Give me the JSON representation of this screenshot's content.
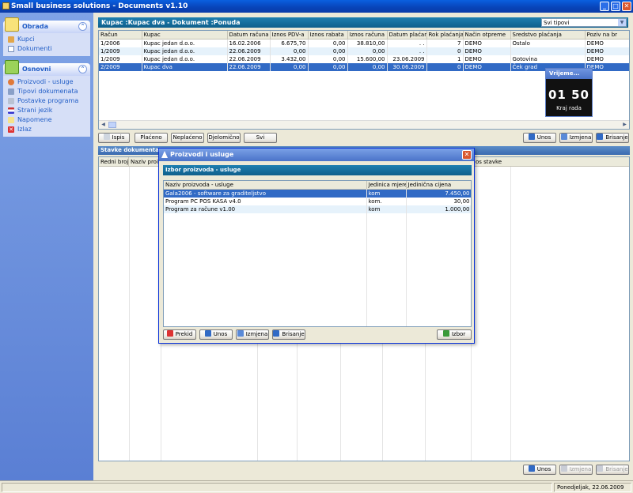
{
  "window": {
    "title": "Small business solutions - Documents v1.10"
  },
  "sidebar": {
    "groups": [
      {
        "title": "Obrada",
        "items": [
          "Kupci",
          "Dokumenti"
        ]
      },
      {
        "title": "Osnovni",
        "items": [
          "Proizvodi - usluge",
          "Tipovi dokumenata",
          "Postavke programa",
          "Strani jezik",
          "Napomene",
          "Izlaz"
        ]
      }
    ]
  },
  "documents": {
    "header": "Kupac :Kupac dva - Dokument :Ponuda",
    "filter_value": "Svi tipovi",
    "columns": [
      "Račun",
      "Kupac",
      "Datum računa",
      "Iznos PDV-a",
      "Iznos rabata",
      "Iznos računa",
      "Datum plaćanja",
      "Rok plaćanja",
      "Način otpreme",
      "Sredstvo plaćanja",
      "Poziv na br"
    ],
    "rows": [
      [
        "1/2006",
        "Kupac jedan d.o.o.",
        "16.02.2006",
        "6.675,70",
        "0,00",
        "38.810,00",
        ". .",
        "7",
        "DEMO",
        "Ostalo",
        "DEMO"
      ],
      [
        "1/2009",
        "Kupac jedan d.o.o.",
        "22.06.2009",
        "0,00",
        "0,00",
        "0,00",
        ". .",
        "0",
        "DEMO",
        "",
        "DEMO"
      ],
      [
        "1/2009",
        "Kupac jedan d.o.o.",
        "22.06.2009",
        "3.432,00",
        "0,00",
        "15.600,00",
        "23.06.2009",
        "1",
        "DEMO",
        "Gotovina",
        "DEMO"
      ],
      [
        "2/2009",
        "Kupac dva",
        "22.06.2009",
        "0,00",
        "0,00",
        "0,00",
        "30.06.2009",
        "0",
        "DEMO",
        "Ček grad",
        "DEMO"
      ]
    ]
  },
  "doc_buttons": {
    "ispis": "Ispis",
    "placeno": "Plaćeno",
    "neplaceno": "Neplaćeno",
    "djelomicno": "Djelomično",
    "svi": "Svi",
    "unos": "Unos",
    "izmjena": "Izmjena",
    "brisanje": "Brisanje"
  },
  "items": {
    "header": "Stavke dokumenta 2",
    "columns": [
      "Redni broj",
      "Naziv proizv",
      "os stavke"
    ]
  },
  "items_buttons": {
    "unos": "Unos",
    "izmjena": "Izmjena",
    "brisanje": "Brisanje"
  },
  "timer": {
    "title": "Vrijeme...",
    "time": "01 50",
    "label": "Kraj rada"
  },
  "dialog": {
    "title": "Proizvodi i usluge",
    "subheader": "Izbor proizvoda - usluge",
    "columns": [
      "Naziv proizvoda - usluge",
      "Jedinica mjere",
      "Jedinična cijena"
    ],
    "rows": [
      [
        "Gala2006 - software za graditeljstvo",
        "kom",
        "7.450,00"
      ],
      [
        "Program PC POS KASA v4.0",
        "kom.",
        "30,00"
      ],
      [
        "Program za račune v1.00",
        "kom",
        "1.000,00"
      ]
    ],
    "buttons": {
      "prekid": "Prekid",
      "unos": "Unos",
      "izmjena": "Izmjena",
      "brisanje": "Brisanje",
      "izbor": "Izbor"
    }
  },
  "status": {
    "date": "Ponedjeljak, 22.06.2009"
  },
  "colors": {
    "accent": "#316ac5",
    "header": "#0f5f8c",
    "sidebar": "#6b8fdc"
  }
}
